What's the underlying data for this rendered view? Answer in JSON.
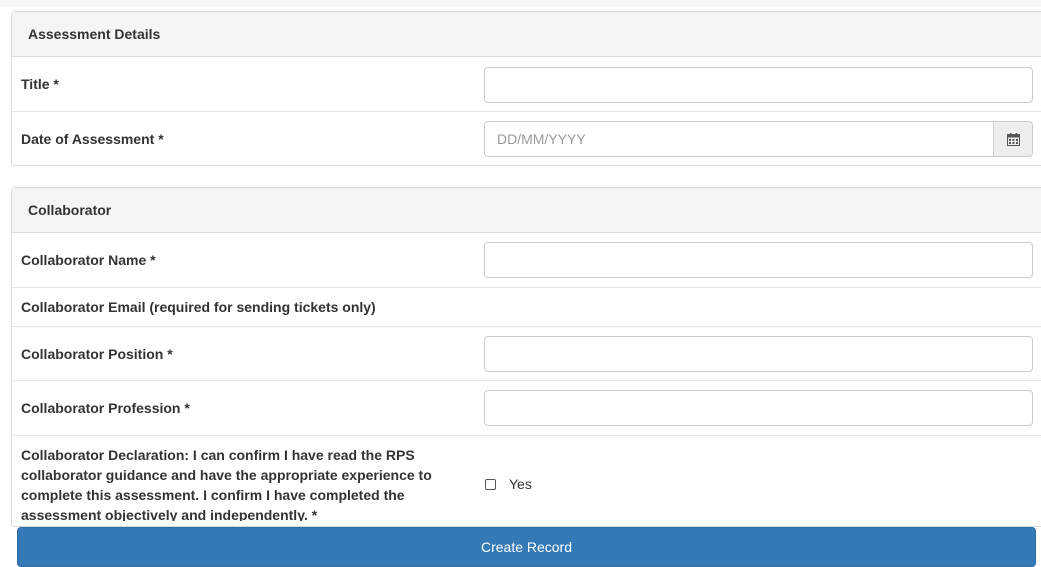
{
  "assessment": {
    "heading": "Assessment Details",
    "title_label": "Title *",
    "title_value": "",
    "date_label": "Date of Assessment *",
    "date_placeholder": "DD/MM/YYYY",
    "calendar_icon": "calendar-icon"
  },
  "collaborator": {
    "heading": "Collaborator",
    "name_label": "Collaborator Name *",
    "name_value": "",
    "email_label": "Collaborator Email (required for sending tickets only)",
    "position_label": "Collaborator Position *",
    "position_value": "",
    "profession_label": "Collaborator Profession *",
    "profession_value": "",
    "declaration_label": "Collaborator Declaration: I can confirm I have read the RPS collaborator guidance and have the appropriate experience to complete this assessment. I confirm I have completed the assessment objectively and independently. *",
    "declaration_option": "Yes",
    "declaration_checked": false
  },
  "actions": {
    "create_label": "Create Record"
  },
  "colors": {
    "primary": "#337ab7",
    "panel_heading_bg": "#f5f5f5",
    "border": "#dcdcdc"
  }
}
